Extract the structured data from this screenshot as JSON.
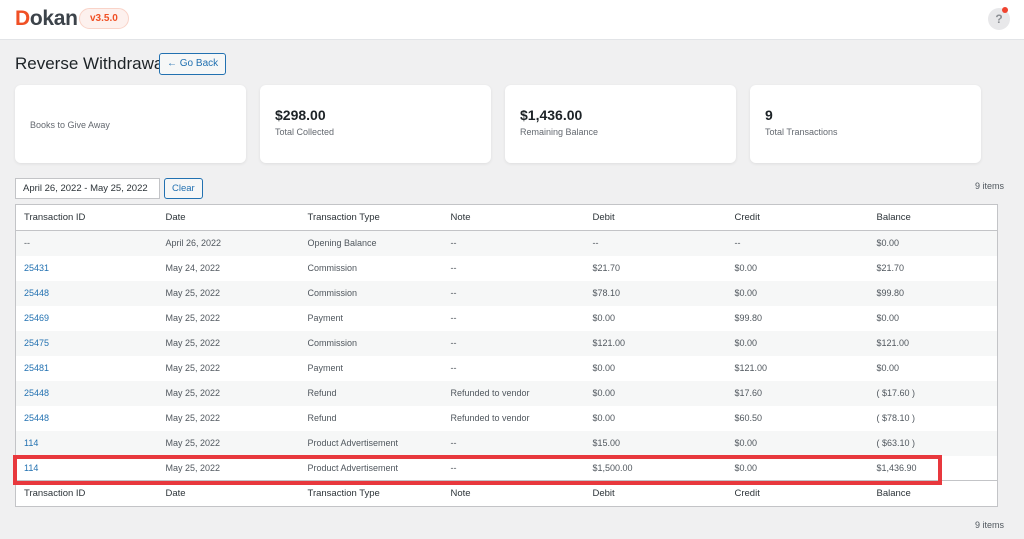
{
  "header": {
    "logo_initial": "D",
    "logo_rest": "okan",
    "version": "v3.5.0",
    "help_icon": "?"
  },
  "page": {
    "title": "Reverse Withdrawal",
    "go_back": "← Go Back"
  },
  "cards": [
    {
      "value": "",
      "label": "Books to Give Away"
    },
    {
      "value": "$298.00",
      "label": "Total Collected"
    },
    {
      "value": "$1,436.00",
      "label": "Remaining Balance"
    },
    {
      "value": "9",
      "label": "Total Transactions"
    }
  ],
  "filter": {
    "date_range": "April 26, 2022 - May 25, 2022",
    "clear": "Clear"
  },
  "items_count": "9 items",
  "table": {
    "columns": [
      "Transaction ID",
      "Date",
      "Transaction Type",
      "Note",
      "Debit",
      "Credit",
      "Balance"
    ],
    "rows": [
      {
        "id": "--",
        "link": false,
        "date": "April 26, 2022",
        "type": "Opening Balance",
        "note": "--",
        "debit": "--",
        "credit": "--",
        "balance": "$0.00"
      },
      {
        "id": "25431",
        "link": true,
        "date": "May 24, 2022",
        "type": "Commission",
        "note": "--",
        "debit": "$21.70",
        "credit": "$0.00",
        "balance": "$21.70"
      },
      {
        "id": "25448",
        "link": true,
        "date": "May 25, 2022",
        "type": "Commission",
        "note": "--",
        "debit": "$78.10",
        "credit": "$0.00",
        "balance": "$99.80"
      },
      {
        "id": "25469",
        "link": true,
        "date": "May 25, 2022",
        "type": "Payment",
        "note": "--",
        "debit": "$0.00",
        "credit": "$99.80",
        "balance": "$0.00"
      },
      {
        "id": "25475",
        "link": true,
        "date": "May 25, 2022",
        "type": "Commission",
        "note": "--",
        "debit": "$121.00",
        "credit": "$0.00",
        "balance": "$121.00"
      },
      {
        "id": "25481",
        "link": true,
        "date": "May 25, 2022",
        "type": "Payment",
        "note": "--",
        "debit": "$0.00",
        "credit": "$121.00",
        "balance": "$0.00"
      },
      {
        "id": "25448",
        "link": true,
        "date": "May 25, 2022",
        "type": "Refund",
        "note": "Refunded to vendor",
        "debit": "$0.00",
        "credit": "$17.60",
        "balance": "( $17.60 )"
      },
      {
        "id": "25448",
        "link": true,
        "date": "May 25, 2022",
        "type": "Refund",
        "note": "Refunded to vendor",
        "debit": "$0.00",
        "credit": "$60.50",
        "balance": "( $78.10 )"
      },
      {
        "id": "114",
        "link": true,
        "date": "May 25, 2022",
        "type": "Product Advertisement",
        "note": "--",
        "debit": "$15.00",
        "credit": "$0.00",
        "balance": "( $63.10 )"
      },
      {
        "id": "114",
        "link": true,
        "date": "May 25, 2022",
        "type": "Product Advertisement",
        "note": "--",
        "debit": "$1,500.00",
        "credit": "$0.00",
        "balance": "$1,436.90"
      }
    ]
  },
  "colors": {
    "brand": "#f05025",
    "link": "#2271b1",
    "highlight": "#e8383d"
  }
}
